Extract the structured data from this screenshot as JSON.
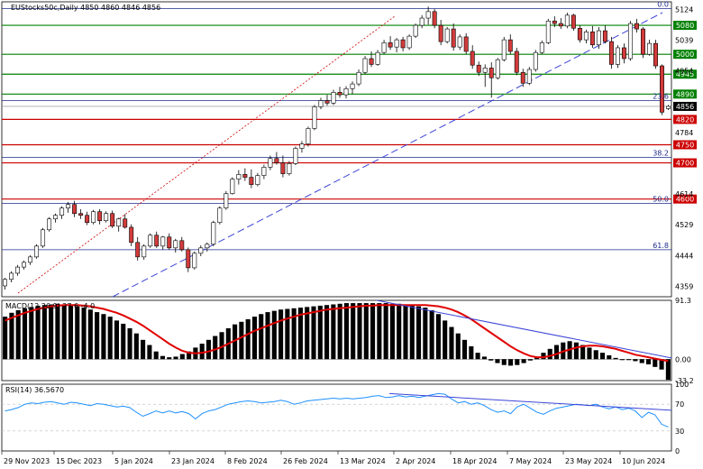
{
  "header": {
    "title": "EUStocks50c,Daily  4850 4860 4846 4856"
  },
  "colors": {
    "bull": "#ffffff",
    "bear": "#d23b3b",
    "support": "#cc0000",
    "resistance": "#008000",
    "fibo": "#1d2a8c",
    "trend": "#3c45d6",
    "macd_signal": "#e00000",
    "rsi": "#1e90ff",
    "current_price_bg": "#000000"
  },
  "chart_data": [
    {
      "type": "candlestick",
      "title": "EUStocks50c,Daily  4850 4860 4846 4856",
      "x_ticks": [
        "29 Nov 2023",
        "15 Dec 2023",
        "5 Jan 2024",
        "23 Jan 2024",
        "8 Feb 2024",
        "26 Feb 2024",
        "13 Mar 2024",
        "2 Apr 2024",
        "18 Apr 2024",
        "7 May 2024",
        "23 May 2024",
        "10 Jun 2024"
      ],
      "y_ticks": [
        5124,
        5039,
        4954,
        4784,
        4614,
        4529,
        4444,
        4359
      ],
      "ylim": [
        4330,
        5145
      ],
      "candles": [
        [
          4360,
          4382,
          4350,
          4378
        ],
        [
          4378,
          4400,
          4370,
          4395
        ],
        [
          4395,
          4418,
          4388,
          4412
        ],
        [
          4412,
          4430,
          4405,
          4425
        ],
        [
          4425,
          4445,
          4418,
          4440
        ],
        [
          4440,
          4475,
          4435,
          4470
        ],
        [
          4470,
          4520,
          4465,
          4515
        ],
        [
          4515,
          4550,
          4510,
          4545
        ],
        [
          4545,
          4560,
          4535,
          4555
        ],
        [
          4555,
          4580,
          4545,
          4575
        ],
        [
          4575,
          4592,
          4562,
          4585
        ],
        [
          4585,
          4595,
          4550,
          4560
        ],
        [
          4560,
          4572,
          4545,
          4555
        ],
        [
          4555,
          4565,
          4528,
          4535
        ],
        [
          4535,
          4570,
          4530,
          4565
        ],
        [
          4565,
          4572,
          4530,
          4540
        ],
        [
          4540,
          4566,
          4535,
          4560
        ],
        [
          4560,
          4568,
          4520,
          4525
        ],
        [
          4525,
          4548,
          4510,
          4545
        ],
        [
          4545,
          4558,
          4518,
          4522
        ],
        [
          4522,
          4530,
          4470,
          4480
        ],
        [
          4480,
          4495,
          4430,
          4440
        ],
        [
          4440,
          4475,
          4432,
          4470
        ],
        [
          4470,
          4505,
          4465,
          4500
        ],
        [
          4500,
          4510,
          4465,
          4470
        ],
        [
          4470,
          4498,
          4460,
          4495
        ],
        [
          4495,
          4505,
          4460,
          4465
        ],
        [
          4465,
          4490,
          4452,
          4485
        ],
        [
          4485,
          4495,
          4455,
          4460
        ],
        [
          4460,
          4466,
          4398,
          4410
        ],
        [
          4410,
          4455,
          4405,
          4450
        ],
        [
          4450,
          4472,
          4442,
          4465
        ],
        [
          4465,
          4480,
          4455,
          4475
        ],
        [
          4475,
          4540,
          4470,
          4535
        ],
        [
          4535,
          4580,
          4530,
          4575
        ],
        [
          4575,
          4622,
          4570,
          4615
        ],
        [
          4615,
          4660,
          4612,
          4655
        ],
        [
          4655,
          4680,
          4640,
          4668
        ],
        [
          4668,
          4685,
          4650,
          4660
        ],
        [
          4660,
          4682,
          4630,
          4640
        ],
        [
          4640,
          4672,
          4635,
          4665
        ],
        [
          4665,
          4695,
          4655,
          4688
        ],
        [
          4688,
          4720,
          4680,
          4712
        ],
        [
          4712,
          4730,
          4695,
          4700
        ],
        [
          4700,
          4720,
          4660,
          4670
        ],
        [
          4670,
          4705,
          4665,
          4698
        ],
        [
          4698,
          4745,
          4694,
          4740
        ],
        [
          4740,
          4760,
          4728,
          4752
        ],
        [
          4752,
          4800,
          4745,
          4795
        ],
        [
          4795,
          4860,
          4790,
          4855
        ],
        [
          4855,
          4880,
          4848,
          4872
        ],
        [
          4872,
          4888,
          4858,
          4865
        ],
        [
          4865,
          4902,
          4860,
          4895
        ],
        [
          4895,
          4910,
          4880,
          4888
        ],
        [
          4888,
          4912,
          4878,
          4905
        ],
        [
          4905,
          4925,
          4890,
          4918
        ],
        [
          4918,
          4958,
          4912,
          4950
        ],
        [
          4950,
          4995,
          4945,
          4988
        ],
        [
          4988,
          5008,
          4965,
          4972
        ],
        [
          4972,
          5012,
          4968,
          5005
        ],
        [
          5005,
          5040,
          5000,
          5032
        ],
        [
          5032,
          5050,
          5012,
          5020
        ],
        [
          5020,
          5045,
          5005,
          5040
        ],
        [
          5040,
          5048,
          5008,
          5018
        ],
        [
          5018,
          5055,
          5012,
          5050
        ],
        [
          5050,
          5085,
          5045,
          5080
        ],
        [
          5080,
          5108,
          5072,
          5100
        ],
        [
          5100,
          5132,
          5082,
          5118
        ],
        [
          5118,
          5125,
          5072,
          5080
        ],
        [
          5080,
          5095,
          5025,
          5035
        ],
        [
          5035,
          5075,
          5030,
          5070
        ],
        [
          5070,
          5085,
          5010,
          5020
        ],
        [
          5020,
          5055,
          5012,
          5048
        ],
        [
          5048,
          5058,
          5000,
          5008
        ],
        [
          5008,
          5025,
          4960,
          4970
        ],
        [
          4970,
          4980,
          4940,
          4950
        ],
        [
          4950,
          4972,
          4910,
          4962
        ],
        [
          4962,
          4978,
          4880,
          4935
        ],
        [
          4935,
          4990,
          4930,
          4985
        ],
        [
          4985,
          5048,
          4980,
          5040
        ],
        [
          5040,
          5055,
          5000,
          5008
        ],
        [
          5008,
          5018,
          4942,
          4950
        ],
        [
          4950,
          4960,
          4910,
          4920
        ],
        [
          4920,
          4965,
          4915,
          4958
        ],
        [
          4958,
          5012,
          4952,
          5005
        ],
        [
          5005,
          5038,
          5000,
          5032
        ],
        [
          5032,
          5098,
          5028,
          5092
        ],
        [
          5092,
          5105,
          5075,
          5085
        ],
        [
          5085,
          5100,
          5070,
          5078
        ],
        [
          5078,
          5115,
          5072,
          5108
        ],
        [
          5108,
          5112,
          5065,
          5072
        ],
        [
          5072,
          5080,
          5032,
          5040
        ],
        [
          5040,
          5068,
          5030,
          5062
        ],
        [
          5062,
          5078,
          5018,
          5026
        ],
        [
          5026,
          5075,
          5015,
          5065
        ],
        [
          5065,
          5080,
          5030,
          5035
        ],
        [
          5035,
          5048,
          4960,
          4972
        ],
        [
          4972,
          5025,
          4962,
          5018
        ],
        [
          5018,
          5030,
          4975,
          4988
        ],
        [
          4988,
          5092,
          4982,
          5085
        ],
        [
          5085,
          5098,
          5060,
          5070
        ],
        [
          5070,
          5075,
          4990,
          5000
        ],
        [
          5000,
          5040,
          4996,
          5030
        ],
        [
          5030,
          5040,
          4960,
          4968
        ],
        [
          4968,
          4972,
          4832,
          4840
        ],
        [
          4850,
          4860,
          4846,
          4856
        ]
      ],
      "hlines_green": [
        5080,
        5000,
        4945,
        4890
      ],
      "hlines_red": [
        4820,
        4750,
        4700,
        4600
      ],
      "fibo_levels": [
        {
          "label": "0.0",
          "value": 5126
        },
        {
          "label": "23.6",
          "value": 4872
        },
        {
          "label": "38.2",
          "value": 4715
        },
        {
          "label": "50.0",
          "value": 4588
        },
        {
          "label": "61.8",
          "value": 4460
        }
      ],
      "price_labels": {
        "green": [
          "5080",
          "5000",
          "4945",
          "4890"
        ],
        "red": [
          "4820",
          "4750",
          "4700",
          "4600"
        ],
        "current": "4856"
      },
      "axis_tick_labels": [
        "5124",
        "5039",
        "4954",
        "4784",
        "4614",
        "4529",
        "4444",
        "4359"
      ]
    },
    {
      "type": "histogram",
      "title": "MACD(12,26,9) 27.6 -4.0",
      "ylim": [
        -33.2,
        91.3
      ],
      "y_ticks": [
        "91.3",
        "0.00",
        "-33.2"
      ],
      "histogram": [
        66,
        72,
        76,
        79,
        81,
        83,
        84,
        85,
        86,
        85,
        84,
        82,
        80,
        77,
        73,
        70,
        66,
        60,
        55,
        48,
        40,
        30,
        22,
        12,
        5,
        3,
        4,
        8,
        12,
        18,
        24,
        30,
        36,
        42,
        48,
        54,
        58,
        62,
        66,
        70,
        73,
        75,
        77,
        78,
        79,
        80,
        81,
        82,
        83,
        84,
        85,
        86,
        87,
        87,
        87,
        87,
        87,
        87,
        87,
        86,
        86,
        85,
        84,
        82,
        80,
        76,
        70,
        60,
        50,
        40,
        30,
        20,
        10,
        4,
        -2,
        -6,
        -9,
        -10,
        -9,
        -6,
        -2,
        4,
        10,
        16,
        22,
        26,
        28,
        26,
        22,
        18,
        14,
        10,
        6,
        2,
        0,
        -1,
        -3,
        -6,
        -8,
        -12,
        -16,
        -32
      ],
      "signal": [
        60,
        64,
        68,
        72,
        75,
        78,
        80,
        82,
        83,
        84,
        84,
        84,
        83,
        82,
        80,
        78,
        75,
        72,
        68,
        63,
        58,
        52,
        45,
        38,
        31,
        24,
        18,
        13,
        10,
        9,
        10,
        12,
        15,
        19,
        24,
        29,
        34,
        39,
        44,
        48,
        52,
        56,
        60,
        63,
        66,
        69,
        71,
        73,
        75,
        77,
        78,
        79,
        80,
        81,
        82,
        83,
        83,
        84,
        84,
        84,
        84,
        84,
        84,
        84,
        84,
        83,
        82,
        80,
        77,
        73,
        68,
        62,
        55,
        48,
        41,
        34,
        27,
        20,
        14,
        9,
        5,
        3,
        3,
        5,
        8,
        12,
        15,
        18,
        20,
        21,
        21,
        20,
        18,
        16,
        13,
        10,
        7,
        5,
        3,
        1,
        -1,
        -3
      ]
    },
    {
      "type": "line",
      "title": "RSI(14) 36.5670",
      "ylim": [
        0,
        100
      ],
      "y_ticks": [
        "100",
        "70",
        "30",
        "0"
      ],
      "values": [
        60,
        62,
        65,
        70,
        72,
        71,
        73,
        74,
        72,
        70,
        73,
        72,
        70,
        68,
        71,
        70,
        68,
        66,
        67,
        65,
        58,
        52,
        56,
        60,
        57,
        60,
        57,
        59,
        56,
        48,
        56,
        60,
        62,
        66,
        70,
        72,
        74,
        75,
        74,
        72,
        73,
        74,
        76,
        74,
        70,
        72,
        75,
        76,
        77,
        78,
        79,
        78,
        79,
        78,
        79,
        80,
        82,
        83,
        80,
        81,
        83,
        81,
        82,
        80,
        82,
        84,
        86,
        85,
        78,
        72,
        74,
        70,
        72,
        68,
        62,
        58,
        60,
        56,
        66,
        70,
        64,
        58,
        55,
        60,
        64,
        66,
        68,
        70,
        69,
        68,
        70,
        66,
        63,
        66,
        62,
        64,
        60,
        50,
        58,
        54,
        40,
        36
      ]
    }
  ]
}
